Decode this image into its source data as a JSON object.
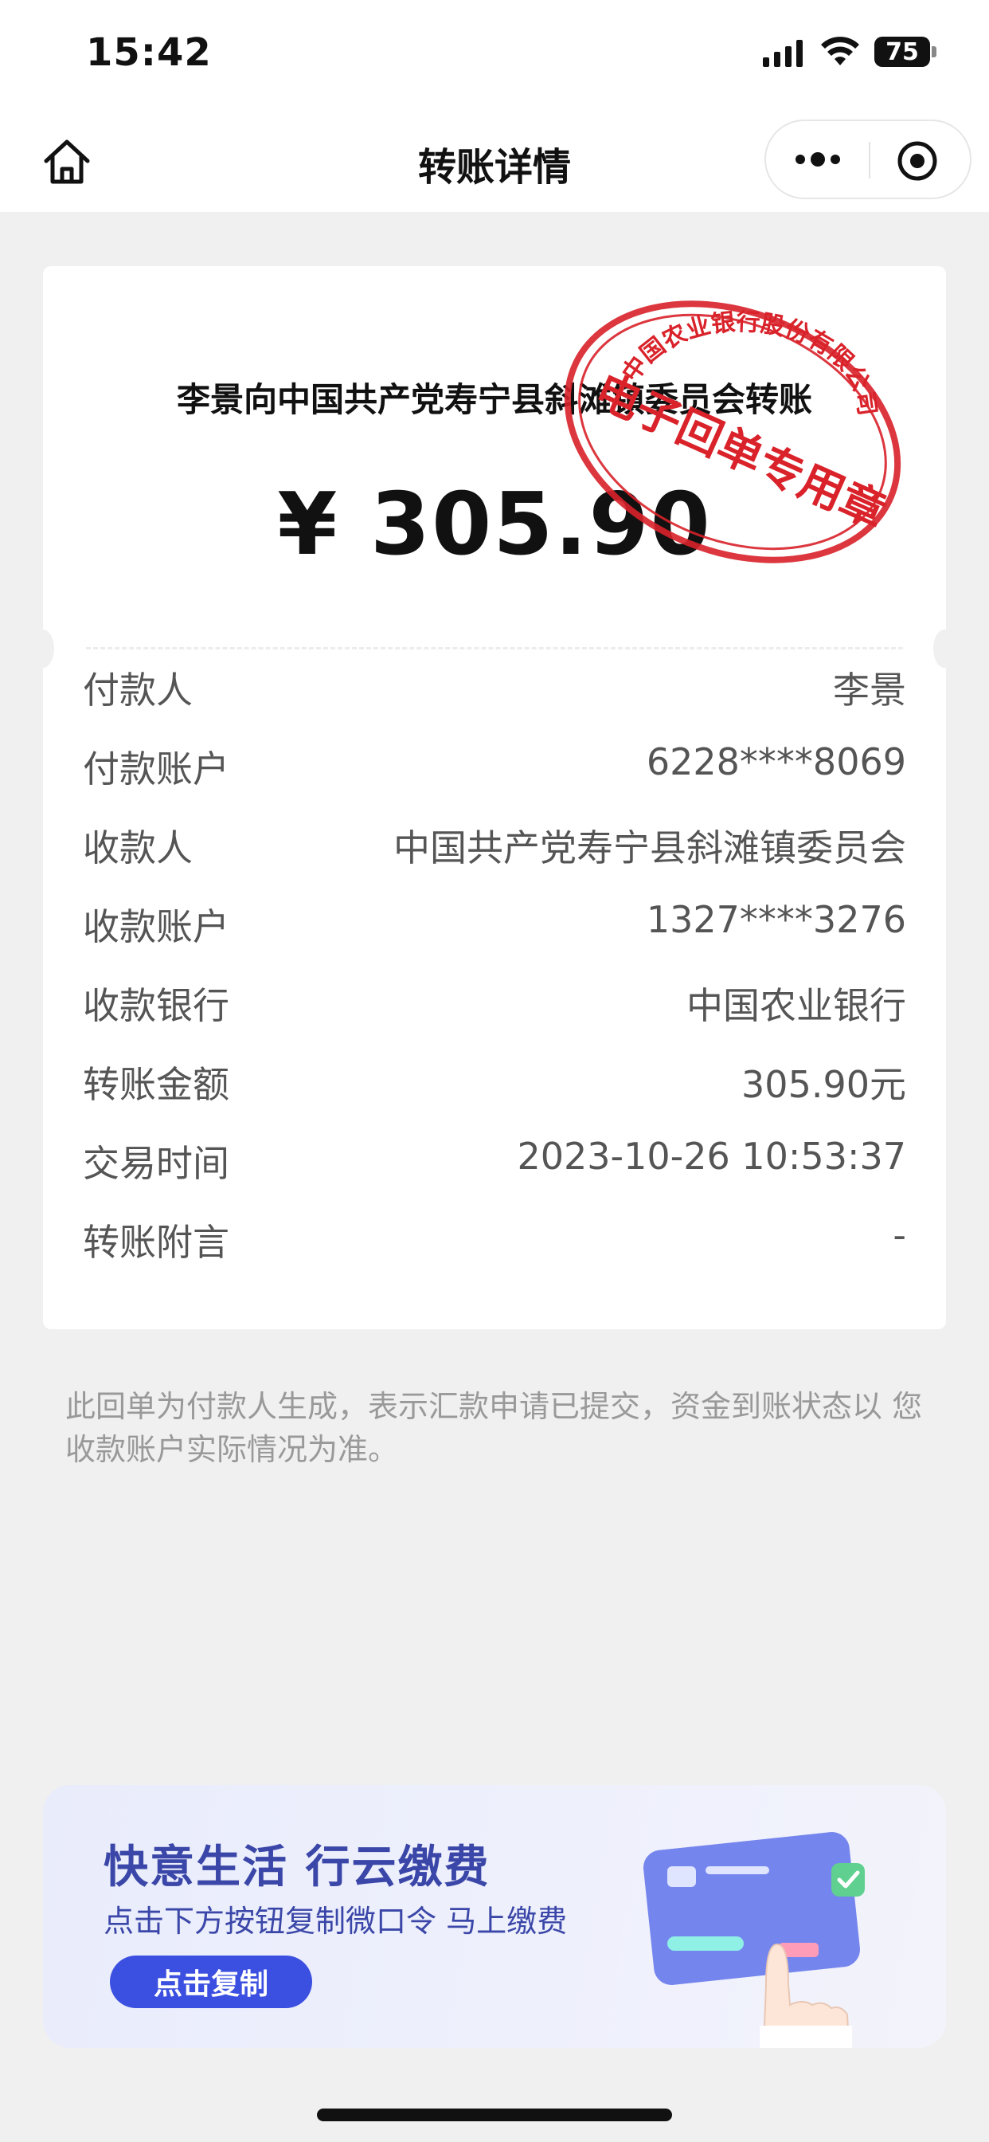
{
  "status_bar": {
    "time": "15:42",
    "battery": "75"
  },
  "nav": {
    "title": "转账详情"
  },
  "receipt": {
    "title": "李景向中国共产党寿宁县斜滩镇委员会转账",
    "amount": "¥ 305.90",
    "stamp": {
      "top_text": "中国农业银行股份有限公司",
      "bottom_text": "电子回单专用章",
      "color": "#d9222a"
    },
    "rows": [
      {
        "label": "付款人",
        "value": "李景"
      },
      {
        "label": "付款账户",
        "value": "6228****8069"
      },
      {
        "label": "收款人",
        "value": "中国共产党寿宁县斜滩镇委员会"
      },
      {
        "label": "收款账户",
        "value": "1327****3276"
      },
      {
        "label": "收款银行",
        "value": "中国农业银行"
      },
      {
        "label": "转账金额",
        "value": "305.90元"
      },
      {
        "label": "交易时间",
        "value": "2023-10-26 10:53:37"
      },
      {
        "label": "转账附言",
        "value": "-"
      }
    ]
  },
  "notice": "此回单为付款人生成，表示汇款申请已提交，资金到账状态以 您收款账户实际情况为准。",
  "banner": {
    "title": "快意生活 行云缴费",
    "subtitle": "点击下方按钮复制微口令  马上缴费",
    "button": "点击复制",
    "accent": "#3b4fe0"
  },
  "icons": [
    "home-icon",
    "more-icon",
    "close-target-icon",
    "signal-icon",
    "wifi-icon",
    "battery-icon"
  ]
}
